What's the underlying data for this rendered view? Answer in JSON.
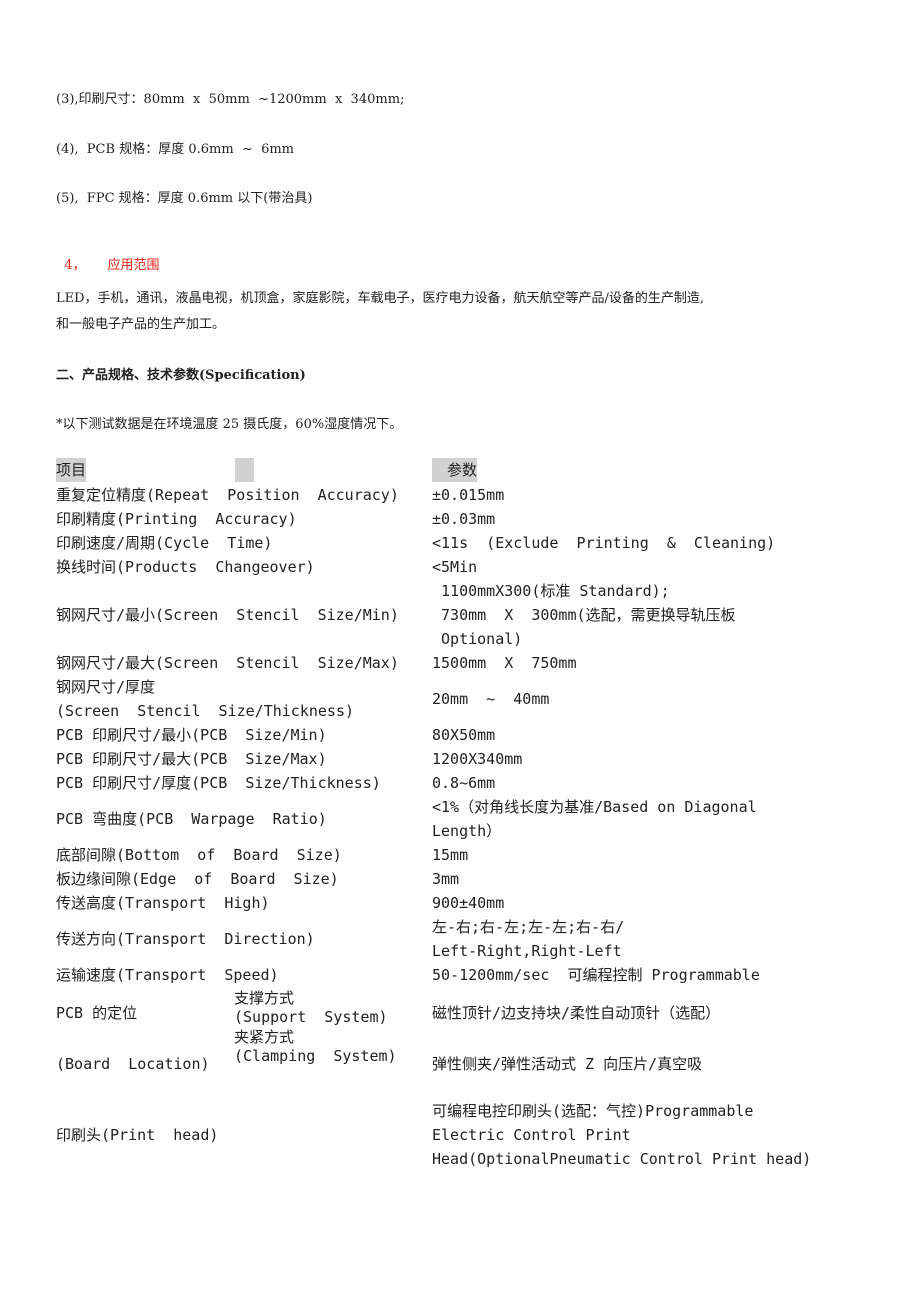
{
  "spec_lines": [
    "(3),印刷尺寸：80mm  x  50mm  ~1200mm  x  340mm;",
    "(4),  PCB 规格：厚度 0.6mm  ~  6mm",
    "(5),  FPC 规格：厚度 0.6mm 以下(带治具)"
  ],
  "section4": {
    "number": "4，",
    "title": "应用范围",
    "color": "#e8211a"
  },
  "applications": [
    "LED，手机，通讯，液晶电视，机顶盒，家庭影院，车载电子，医疗电力设备，航天航空等产品/设备的生产制造,",
    "和一般电子产品的生产加工。"
  ],
  "section2_title": "二、产品规格、技术参数(Specification)",
  "note": "*以下测试数据是在环境温度 25 摄氏度，60%湿度情况下。",
  "table": {
    "header": {
      "item": "项目",
      "mid": "",
      "param": "　参数"
    },
    "rows": [
      {
        "item": "重复定位精度(Repeat  Position  Accuracy)",
        "value": [
          "±0.015mm"
        ]
      },
      {
        "item": "印刷精度(Printing  Accuracy)",
        "value": [
          "±0.03mm"
        ]
      },
      {
        "item": "印刷速度/周期(Cycle  Time)",
        "value": [
          "<11s  (Exclude  Printing  &  Cleaning)"
        ]
      },
      {
        "item": "换线时间(Products  Changeover)",
        "value": [
          "<5Min"
        ]
      },
      {
        "item": "钢网尺寸/最小(Screen  Stencil  Size/Min)",
        "value": [
          " 1100mmX300(标准 Standard);",
          " 730mm  X  300mm(选配，需更换导轨压板",
          " Optional)"
        ]
      },
      {
        "item": "钢网尺寸/最大(Screen  Stencil  Size/Max)",
        "value": [
          "1500mm  X  750mm"
        ]
      },
      {
        "item": "钢网尺寸/厚度\n(Screen  Stencil  Size/Thickness)",
        "value": [
          "20mm  ~  40mm"
        ]
      },
      {
        "item": "PCB 印刷尺寸/最小(PCB  Size/Min)",
        "value": [
          "80X50mm"
        ]
      },
      {
        "item": "PCB 印刷尺寸/最大(PCB  Size/Max)",
        "value": [
          "1200X340mm"
        ]
      },
      {
        "item": "PCB 印刷尺寸/厚度(PCB  Size/Thickness)",
        "value": [
          "0.8~6mm"
        ]
      },
      {
        "item": "PCB 弯曲度(PCB  Warpage  Ratio)",
        "value": [
          "<1%（对角线长度为基准/Based on Diagonal",
          "Length）"
        ]
      },
      {
        "item": "底部间隙(Bottom  of  Board  Size)",
        "value": [
          "15mm"
        ]
      },
      {
        "item": "板边缘间隙(Edge  of  Board  Size)",
        "value": [
          "3mm"
        ]
      },
      {
        "item": "传送高度(Transport  High)",
        "value": [
          "900±40mm"
        ]
      },
      {
        "item": "传送方向(Transport  Direction)",
        "value": [
          "左-右;右-左;左-左;右-右/",
          "Left-Right,Right-Left"
        ]
      },
      {
        "item": "运输速度(Transport  Speed)",
        "value": [
          "50-1200mm/sec  可编程控制 Programmable"
        ]
      }
    ],
    "pcb_location": {
      "label_top": "PCB 的定位",
      "label_bottom": "(Board  Location)",
      "sub": [
        {
          "name": "支撑方式",
          "name_en": "(Support  System)",
          "value": "磁性顶针/边支持块/柔性自动顶针（选配）"
        },
        {
          "name": "夹紧方式",
          "name_en": "(Clamping  System)",
          "value": "弹性侧夹/弹性活动式 Z 向压片/真空吸"
        }
      ]
    },
    "print_head": {
      "item": "印刷头(Print  head)",
      "value": [
        "可编程电控印刷头(选配：气控)Programmable",
        "Electric Control Print",
        "Head(OptionalPneumatic Control Print head)"
      ]
    }
  }
}
